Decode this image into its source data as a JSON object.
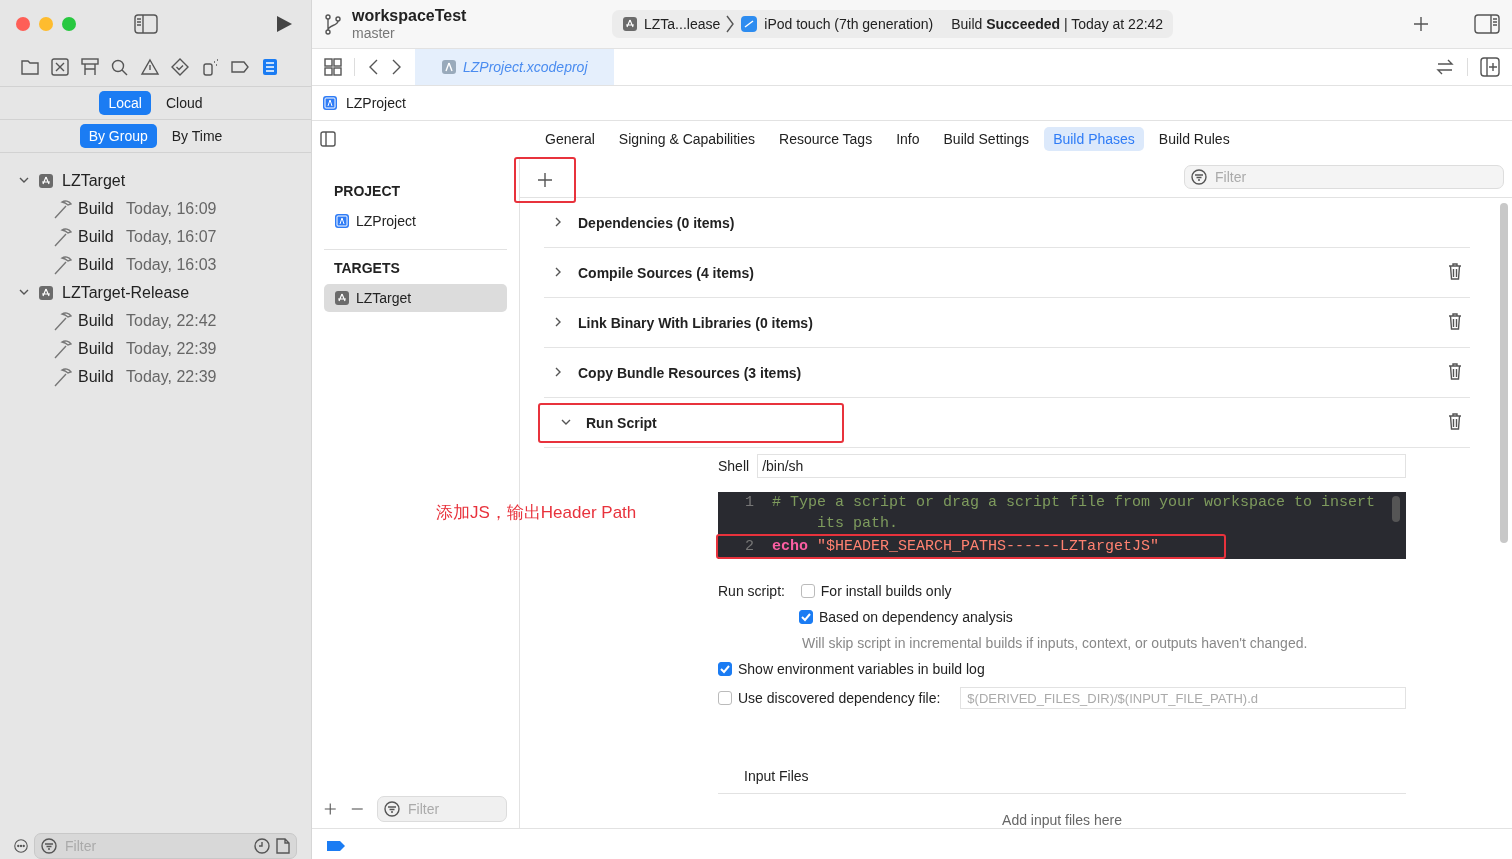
{
  "toolbar": {
    "title": "workspaceTest",
    "branch": "master",
    "scheme": "LZTa...lease",
    "destination": "iPod touch (7th generation)",
    "status": "Build **Succeeded** | Today at 22:42"
  },
  "editor_tab": {
    "label": "LZProject.xcodeproj"
  },
  "navigator": {
    "source_tabs": [
      {
        "label": "Local",
        "selected": true
      },
      {
        "label": "Cloud",
        "selected": false
      }
    ],
    "group_tabs": [
      {
        "label": "By Group",
        "selected": true
      },
      {
        "label": "By Time",
        "selected": false
      }
    ],
    "groups": [
      {
        "name": "LZTarget",
        "expanded": true,
        "children": [
          {
            "action": "Build",
            "time": "Today, 16:09"
          },
          {
            "action": "Build",
            "time": "Today, 16:07"
          },
          {
            "action": "Build",
            "time": "Today, 16:03"
          }
        ]
      },
      {
        "name": "LZTarget-Release",
        "expanded": true,
        "children": [
          {
            "action": "Build",
            "time": "Today, 22:42"
          },
          {
            "action": "Build",
            "time": "Today, 22:39"
          },
          {
            "action": "Build",
            "time": "Today, 22:39"
          }
        ]
      }
    ],
    "filter_placeholder": "Filter"
  },
  "breadcrumb": "LZProject",
  "settings_tabs": [
    {
      "label": "General",
      "selected": false
    },
    {
      "label": "Signing & Capabilities",
      "selected": false
    },
    {
      "label": "Resource Tags",
      "selected": false
    },
    {
      "label": "Info",
      "selected": false
    },
    {
      "label": "Build Settings",
      "selected": false
    },
    {
      "label": "Build Phases",
      "selected": true
    },
    {
      "label": "Build Rules",
      "selected": false
    }
  ],
  "project_list": {
    "project_header": "PROJECT",
    "projects": [
      "LZProject"
    ],
    "targets_header": "TARGETS",
    "targets": [
      {
        "label": "LZTarget",
        "selected": true
      }
    ],
    "filter_placeholder": "Filter"
  },
  "phases_filter_placeholder": "Filter",
  "phases": [
    {
      "title": "Dependencies (0 items)",
      "expanded": false,
      "deletable": false
    },
    {
      "title": "Compile Sources (4 items)",
      "expanded": false,
      "deletable": true
    },
    {
      "title": "Link Binary With Libraries (0 items)",
      "expanded": false,
      "deletable": true
    },
    {
      "title": "Copy Bundle Resources (3 items)",
      "expanded": false,
      "deletable": true
    },
    {
      "title": "Run Script",
      "expanded": true,
      "deletable": true
    }
  ],
  "run_script": {
    "shell_label": "Shell",
    "shell": "/bin/sh",
    "code_lines": [
      {
        "number": "1",
        "kind": "comment",
        "text": "# Type a script or drag a script file from your workspace to insert its path."
      },
      {
        "number": "2",
        "kind": "command",
        "keyword": "echo",
        "text": "\"$HEADER_SEARCH_PATHS------LZTargetJS\""
      }
    ],
    "run_script_label": "Run script:",
    "options": [
      {
        "label": "For install builds only",
        "checked": false
      },
      {
        "label": "Based on dependency analysis",
        "checked": true
      }
    ],
    "note": "Will skip script in incremental builds if inputs, context, or outputs haven't changed.",
    "show_env": {
      "label": "Show environment variables in build log",
      "checked": true
    },
    "dep_file": {
      "label": "Use discovered dependency file:",
      "checked": false,
      "placeholder": "$(DERIVED_FILES_DIR)/$(INPUT_FILE_PATH).d"
    },
    "input_files_header": "Input Files",
    "input_files_hint": "Add input files here"
  },
  "annotation": "添加JS，输出Header Path"
}
